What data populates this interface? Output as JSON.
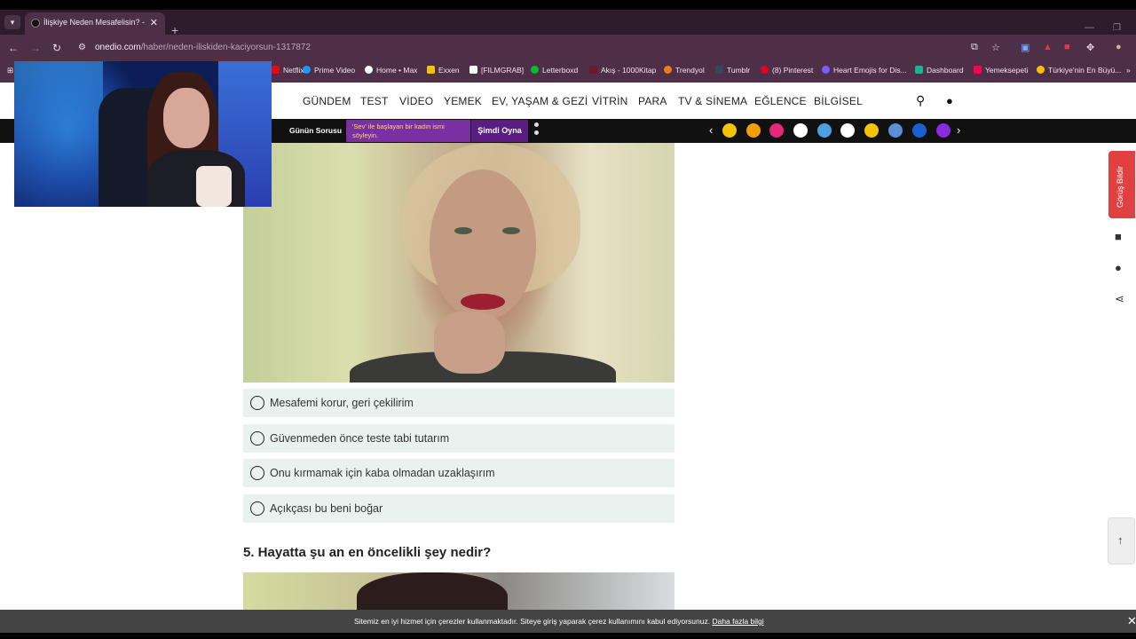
{
  "browser": {
    "tab_title": "İlişkiye Neden Mesafelisin? - O",
    "tab_close": "✕",
    "new_tab": "+",
    "url_host": "onedio.com",
    "url_path": "/haber/neden-iliskiden-kaciyorsun-1317872"
  },
  "bookmarks": [
    {
      "label": "Netflix",
      "color": "#e50914"
    },
    {
      "label": "Prime Video",
      "color": "#1a98ff"
    },
    {
      "label": "Home • Max",
      "color": "#ffffff"
    },
    {
      "label": "Exxen",
      "color": "#f5c400"
    },
    {
      "label": "[FILMGRAB]",
      "color": "#ffffff"
    },
    {
      "label": "Letterboxd",
      "color": "#00c030"
    },
    {
      "label": "Akış - 1000Kitap",
      "color": "#6b1a2a"
    },
    {
      "label": "Trendyol",
      "color": "#f27a1a"
    },
    {
      "label": "Tumblr",
      "color": "#36465d"
    },
    {
      "label": "(8) Pinterest",
      "color": "#e60023"
    },
    {
      "label": "Heart Emojis for Dis...",
      "color": "#7b5cff"
    },
    {
      "label": "Dashboard",
      "color": "#1ab394"
    },
    {
      "label": "Yemeksepeti",
      "color": "#fa0050"
    },
    {
      "label": "Türkiye'nin En Büyü...",
      "color": "#f5c400"
    }
  ],
  "nav": {
    "items": [
      "GÜNDEM",
      "TEST",
      "VİDEO",
      "YEMEK",
      "EV, YAŞAM & GEZİ",
      "VİTRİN",
      "PARA",
      "TV & SİNEMA",
      "EĞLENCE",
      "BİLGİSEL"
    ]
  },
  "gamebar": {
    "label": "Günün Sorusu",
    "question": "'Sev' ile başlayan bir kadın ismi söyleyin.",
    "play": "Şimdi Oyna",
    "prev": "‹",
    "next": "›",
    "badge_colors": [
      "#f5c400",
      "#f29f05",
      "#e6287a",
      "#ffffff",
      "#4aa3e0",
      "#ffffff",
      "#f5c400",
      "#5b8fd6",
      "#1a5fd0",
      "#8a2be2"
    ]
  },
  "options": [
    "Mesafemi korur, geri çekilirim",
    "Güvenmeden önce teste tabi tutarım",
    "Onu kırmamak için kaba olmadan uzaklaşırım",
    "Açıkçası bu beni boğar"
  ],
  "question5": "5. Hayatta şu an en öncelikli şey nedir?",
  "side": {
    "feedback": "Görüş Bildir",
    "scroll_top": "↑"
  },
  "cookie": {
    "text": "Sitemiz en iyi hizmet için çerezler kullanmaktadır. Siteye giriş yaparak çerez kullanımını kabul ediyorsunuz.",
    "link": "Daha fazla bilgi",
    "close": "✕"
  }
}
